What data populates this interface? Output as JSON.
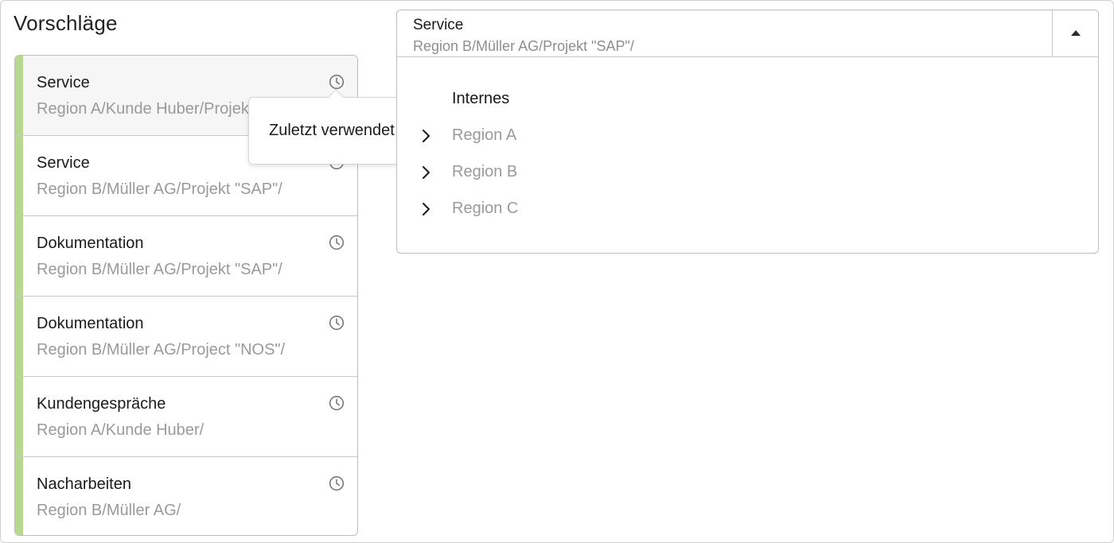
{
  "heading": "Vorschläge",
  "suggestions": [
    {
      "title": "Service",
      "path": "Region A/Kunde Huber/Projekt \"SAP\"/"
    },
    {
      "title": "Service",
      "path": "Region B/Müller AG/Projekt \"SAP\"/"
    },
    {
      "title": "Dokumentation",
      "path": "Region B/Müller AG/Projekt \"SAP\"/"
    },
    {
      "title": "Dokumentation",
      "path": "Region B/Müller AG/Project \"NOS\"/"
    },
    {
      "title": "Kundengespräche",
      "path": "Region A/Kunde Huber/"
    },
    {
      "title": "Nacharbeiten",
      "path": "Region B/Müller AG/"
    }
  ],
  "tooltip": {
    "text": "Zuletzt verwendet"
  },
  "selector": {
    "title": "Service",
    "path": "Region B/Müller AG/Projekt \"SAP\"/",
    "tree": [
      {
        "label": "Internes",
        "expandable": false
      },
      {
        "label": "Region A",
        "expandable": true
      },
      {
        "label": "Region B",
        "expandable": true
      },
      {
        "label": "Region C",
        "expandable": true
      }
    ]
  },
  "colors": {
    "accent_bar": "#b6d88f",
    "muted_text": "#9a9a9a",
    "border": "#bdbdbd"
  },
  "icons": {
    "suggestion": "clock-icon",
    "select_toggle": "caret-up-icon",
    "tree_expand": "chevron-right-icon"
  }
}
